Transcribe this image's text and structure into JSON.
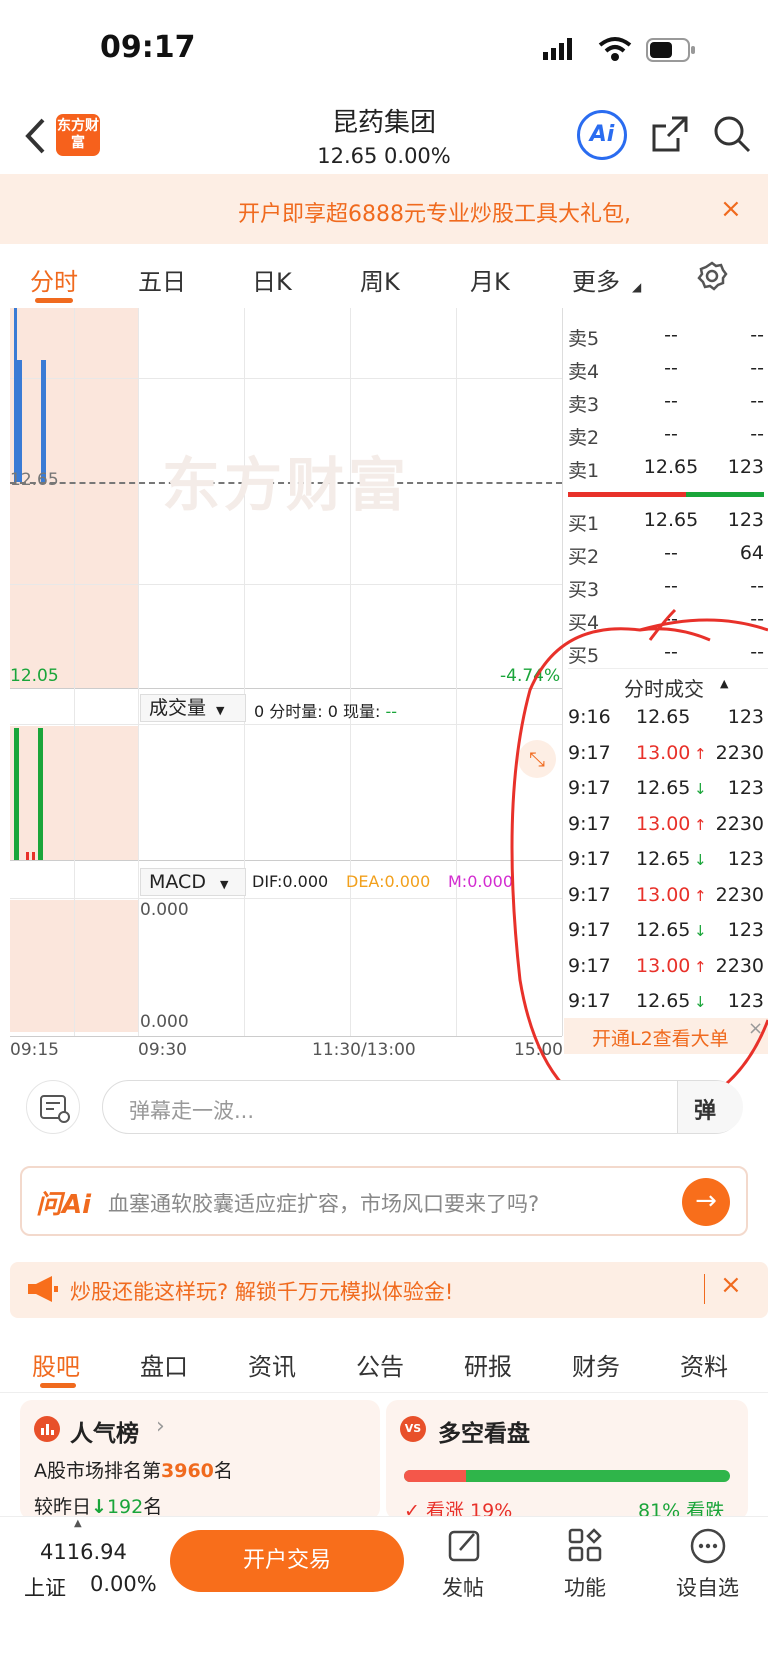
{
  "status_bar": {
    "time": "09:17"
  },
  "header": {
    "logo_text": "东方财富",
    "title": "昆药集团",
    "price_line": "12.65  0.00%",
    "ai_label": "Ai"
  },
  "banner": {
    "text": "开户即享超6888元专业炒股工具大礼包,",
    "close": "×"
  },
  "chart_tabs": [
    {
      "label": "分时"
    },
    {
      "label": "五日"
    },
    {
      "label": "日K"
    },
    {
      "label": "周K"
    },
    {
      "label": "月K"
    },
    {
      "label": "更多"
    }
  ],
  "chart": {
    "watermark": "东方财富",
    "price_ref": "12.65",
    "price_low": "12.05",
    "pct_low": "-4.74%",
    "volume_indicator": "成交量",
    "volume_text": "0 分时量: 0 现量: ",
    "volume_cur": "--",
    "macd_indicator": "MACD",
    "dif": "DIF:0.000",
    "dea": "DEA:0.000",
    "m": "M:0.000",
    "macd_top": "0.000",
    "macd_bottom": "0.000",
    "time_labels": [
      "09:15",
      "09:30",
      "11:30/13:00",
      "15:00"
    ]
  },
  "order_book": {
    "asks": [
      {
        "label": "卖5",
        "price": "--",
        "vol": "--"
      },
      {
        "label": "卖4",
        "price": "--",
        "vol": "--"
      },
      {
        "label": "卖3",
        "price": "--",
        "vol": "--"
      },
      {
        "label": "卖2",
        "price": "--",
        "vol": "--"
      },
      {
        "label": "卖1",
        "price": "12.65",
        "vol": "123"
      }
    ],
    "bids": [
      {
        "label": "买1",
        "price": "12.65",
        "vol": "123"
      },
      {
        "label": "买2",
        "price": "--",
        "vol": "64"
      },
      {
        "label": "买3",
        "price": "--",
        "vol": "--"
      },
      {
        "label": "买4",
        "price": "--",
        "vol": "--"
      },
      {
        "label": "买5",
        "price": "--",
        "vol": "--"
      }
    ]
  },
  "trades": {
    "title": "分时成交",
    "rows": [
      {
        "time": "9:16",
        "price": "12.65",
        "dir": "",
        "vol": "123"
      },
      {
        "time": "9:17",
        "price": "13.00",
        "dir": "↑",
        "vol": "2230"
      },
      {
        "time": "9:17",
        "price": "12.65",
        "dir": "↓",
        "vol": "123"
      },
      {
        "time": "9:17",
        "price": "13.00",
        "dir": "↑",
        "vol": "2230"
      },
      {
        "time": "9:17",
        "price": "12.65",
        "dir": "↓",
        "vol": "123"
      },
      {
        "time": "9:17",
        "price": "13.00",
        "dir": "↑",
        "vol": "2230"
      },
      {
        "time": "9:17",
        "price": "12.65",
        "dir": "↓",
        "vol": "123"
      },
      {
        "time": "9:17",
        "price": "13.00",
        "dir": "↑",
        "vol": "2230"
      },
      {
        "time": "9:17",
        "price": "12.65",
        "dir": "↓",
        "vol": "123"
      }
    ],
    "l2_text": "开通L2查看大单"
  },
  "danmu": {
    "placeholder": "弹幕走一波...",
    "button": "弹"
  },
  "ask_ai": {
    "logo": "问Ai",
    "text": "血塞通软胶囊适应症扩容，市场风口要来了吗?"
  },
  "promo": {
    "text": "炒股还能这样玩? 解锁千万元模拟体验金!"
  },
  "bottom_tabs": [
    {
      "label": "股吧"
    },
    {
      "label": "盘口"
    },
    {
      "label": "资讯"
    },
    {
      "label": "公告"
    },
    {
      "label": "研报"
    },
    {
      "label": "财务"
    },
    {
      "label": "资料"
    }
  ],
  "popularity": {
    "title": "人气榜",
    "rank_prefix": "A股市场排名第",
    "rank": "3960",
    "rank_suffix": "名",
    "change_prefix": "较昨日",
    "change": "192",
    "change_suffix": "名"
  },
  "sentiment": {
    "badge": "VS",
    "title": "多空看盘",
    "bull_label": "看涨",
    "bull_pct": "19%",
    "bear_pct": "81%",
    "bear_label": "看跌",
    "bull_fraction": 0.19
  },
  "bottom_bar": {
    "index_value": "4116.94",
    "index_name": "上证",
    "index_change": "0.00%",
    "open_account": "开户交易",
    "post": "发帖",
    "function": "功能",
    "watchlist": "设自选"
  }
}
